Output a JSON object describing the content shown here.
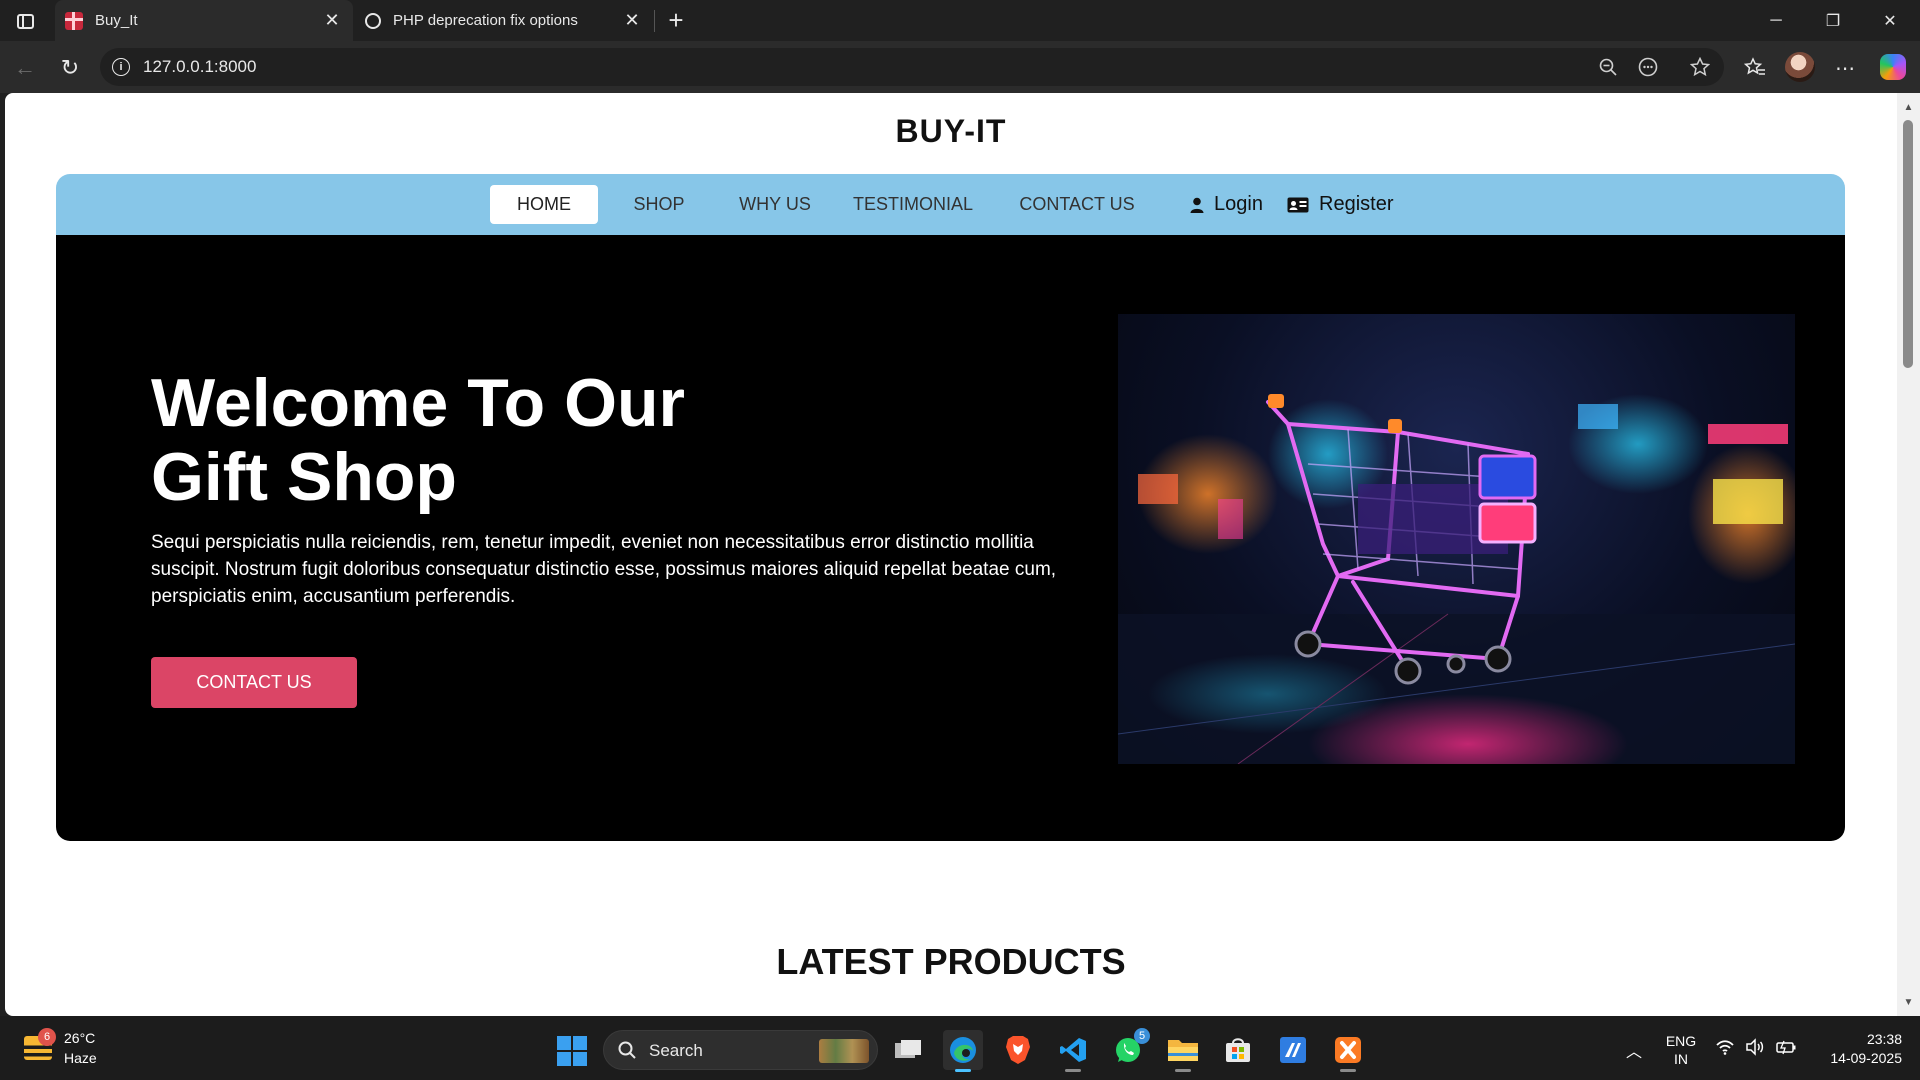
{
  "browser": {
    "tabs": [
      {
        "title": "Buy_It",
        "active": true
      },
      {
        "title": "PHP deprecation fix options",
        "active": false
      }
    ],
    "url": "127.0.0.1:8000"
  },
  "site": {
    "brand": "BUY-IT",
    "nav": {
      "items": [
        {
          "label": "HOME",
          "active": true
        },
        {
          "label": "SHOP",
          "active": false
        },
        {
          "label": "WHY US",
          "active": false
        },
        {
          "label": "TESTIMONIAL",
          "active": false
        },
        {
          "label": "CONTACT US",
          "active": false
        }
      ],
      "login": "Login",
      "register": "Register"
    },
    "hero": {
      "title": "Welcome To Our Gift Shop",
      "text": "Sequi perspiciatis nulla reiciendis, rem, tenetur impedit, eveniet non necessitatibus error distinctio mollitia suscipit. Nostrum fugit doloribus consequatur distinctio esse, possimus maiores aliquid repellat beatae cum, perspiciatis enim, accusantium perferendis.",
      "cta": "CONTACT US",
      "image": "neon-shopping-cart"
    },
    "section_heading": "LATEST PRODUCTS"
  },
  "colors": {
    "nav_bg": "#87c6e8",
    "hero_bg": "#000000",
    "cta_bg": "#db4566"
  },
  "taskbar": {
    "weather": {
      "badge": "6",
      "temp": "26°C",
      "condition": "Haze"
    },
    "search": "Search",
    "whatsapp_badge": "5",
    "lang_line1": "ENG",
    "lang_line2": "IN",
    "time": "23:38",
    "date": "14-09-2025"
  }
}
